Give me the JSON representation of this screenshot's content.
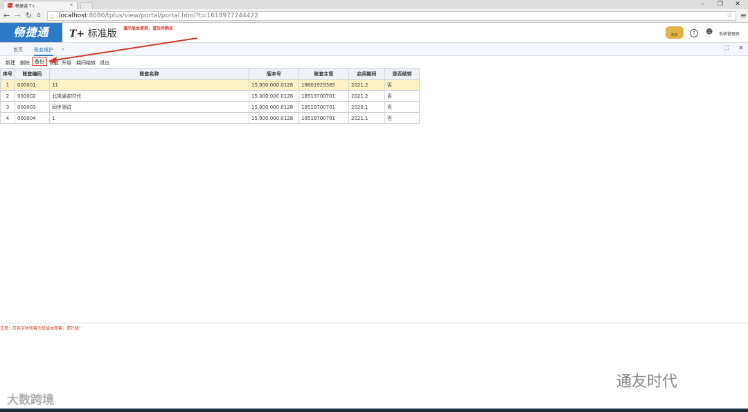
{
  "browser": {
    "tab_title": "畅捷通 T+",
    "tab_favicon": "T+",
    "url_host": "localhost",
    "url_rest": ":8080/tplus/view/portal/portal.html?t=1618977244422",
    "win_min": "–",
    "win_max": "❐",
    "win_close": "✕"
  },
  "header": {
    "logo": "畅捷通",
    "edition_tp": "T+",
    "edition_label": "标准版",
    "annotation": "演示版本使用，请及时购买",
    "badge": "购买",
    "help": "?",
    "user_icon": "person-icon",
    "username": "系统管理员"
  },
  "tabs": [
    {
      "label": "首页"
    },
    {
      "label": "账套维护"
    }
  ],
  "tab_close": "×",
  "toolbar": {
    "items": [
      "新建",
      "删除",
      "备份",
      "恢复",
      "升级",
      "期间结转",
      "退出"
    ]
  },
  "grid": {
    "columns": [
      "序号",
      "账套编码",
      "账套名称",
      "版本号",
      "账套主管",
      "启用期间",
      "是否结转"
    ],
    "rows": [
      [
        "1",
        "000001",
        "11",
        "15.000.000.0128",
        "18601929365",
        "2021.2",
        "否"
      ],
      [
        "2",
        "000002",
        "北京通友时代",
        "15.000.000.0128",
        "18519700701",
        "2021.2",
        "否"
      ],
      [
        "3",
        "000003",
        "同步测试",
        "15.000.000.0128",
        "18519700701",
        "2020.1",
        "否"
      ],
      [
        "4",
        "000004",
        "1",
        "15.000.000.0128",
        "18519700701",
        "2021.1",
        "否"
      ]
    ]
  },
  "notice": "注意：红色字体账套为低版本账套，请升级！",
  "watermarks": {
    "left": "大数跨境",
    "right": "通友时代"
  },
  "colors": {
    "brand_blue": "#2f79c9",
    "annotation_red": "#d03a2a",
    "selected_row": "#fdf2c6"
  }
}
